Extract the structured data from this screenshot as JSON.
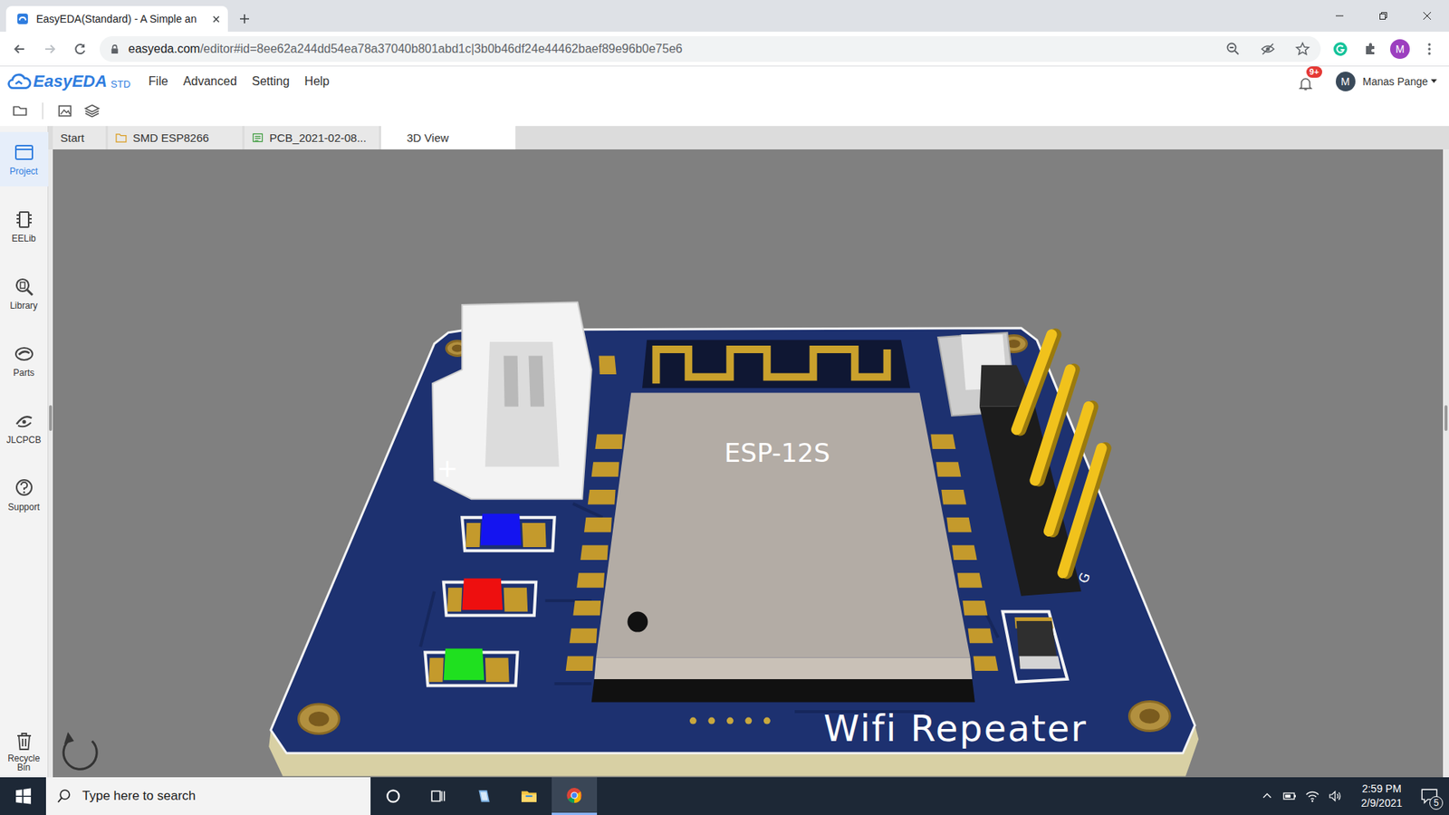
{
  "browser": {
    "tab_title": "EasyEDA(Standard) - A Simple an",
    "url": {
      "host": "easyeda.com",
      "path": "/editor#id=8ee62a244dd54ea78a37040b801abd1c|3b0b46df24e44462baef89e96b0e75e6"
    },
    "profile_initial": "M"
  },
  "app": {
    "logo": "EasyEDA",
    "edition": "STD",
    "menus": [
      "File",
      "Advanced",
      "Setting",
      "Help"
    ],
    "notifications": "9+",
    "user_initial": "M",
    "user_name": "Manas Pange"
  },
  "doc_tabs": [
    {
      "label": "Start",
      "kind": "plain",
      "selected": false
    },
    {
      "label": "SMD ESP8266",
      "kind": "folder",
      "selected": false
    },
    {
      "label": "PCB_2021-02-08...",
      "kind": "pcb",
      "selected": false
    },
    {
      "label": "3D View",
      "kind": "view",
      "selected": true
    }
  ],
  "sidebar": {
    "items": [
      {
        "label": "Project",
        "kind": "project",
        "selected": true
      },
      {
        "label": "EELib",
        "kind": "eelib",
        "selected": false
      },
      {
        "label": "Library",
        "kind": "library",
        "selected": false
      },
      {
        "label": "Parts",
        "kind": "lcsc",
        "selected": false
      },
      {
        "label": "JLCPCB",
        "kind": "jlcpcb",
        "selected": false
      },
      {
        "label": "Support",
        "kind": "support",
        "selected": false
      }
    ],
    "recycle_bin": "Recycle Bin"
  },
  "pcb": {
    "module_label": "ESP-12S",
    "board_label": "Wifi Repeater",
    "polarity_mark": "+",
    "pin_label": "G",
    "leds": [
      {
        "color": "#1414f0"
      },
      {
        "color": "#ee0f0f"
      },
      {
        "color": "#1fe01f"
      }
    ]
  },
  "taskbar": {
    "search_placeholder": "Type here to search",
    "time": "2:59 PM",
    "date": "2/9/2021",
    "notifications": "5"
  }
}
